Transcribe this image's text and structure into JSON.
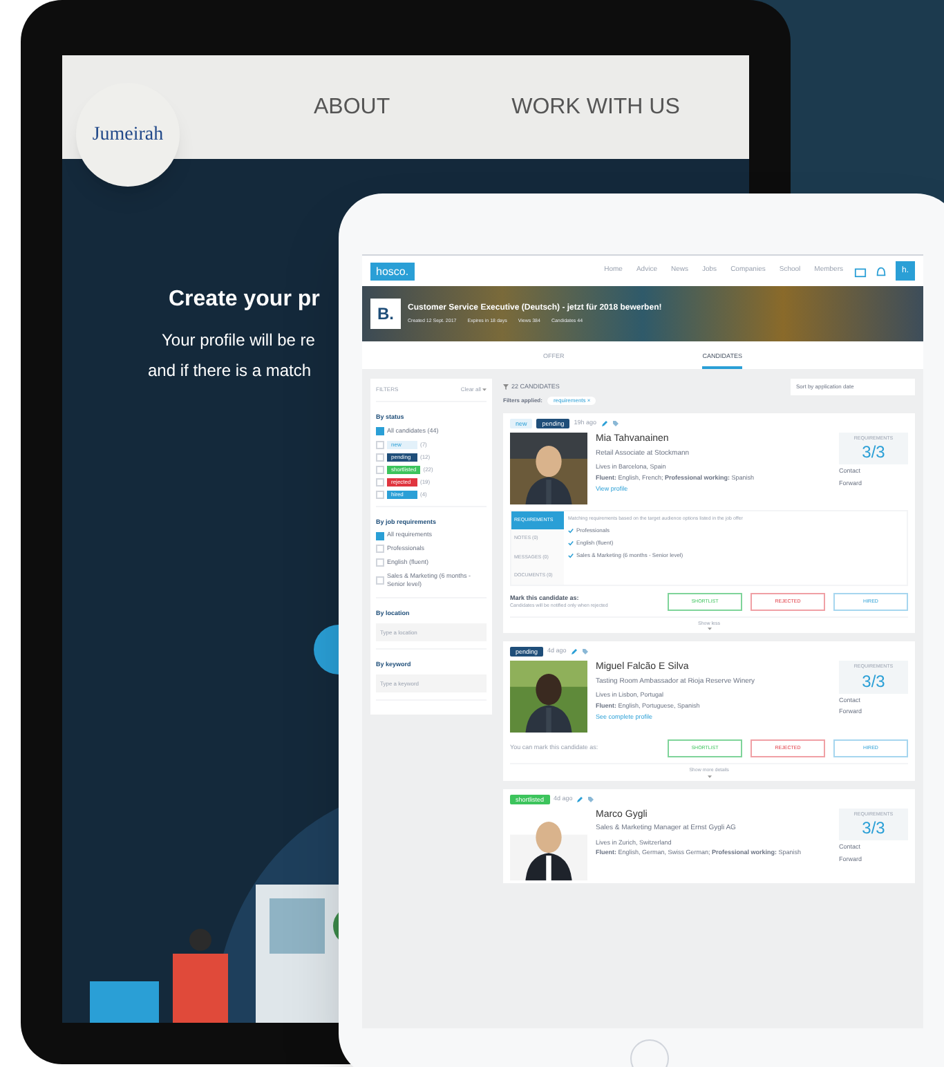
{
  "back_tablet": {
    "logo": "Jumeirah",
    "nav": [
      "ABOUT",
      "WORK WITH US"
    ],
    "headline": "Create your pr",
    "body": [
      "Your profile will be re",
      "and if there is a match"
    ]
  },
  "front_tablet": {
    "topbar": {
      "logo": "hosco.",
      "nav": [
        "Home",
        "Advice",
        "News",
        "Jobs",
        "Companies",
        "School",
        "Members"
      ],
      "avatar": "h."
    },
    "banner": {
      "company_logo": "B.",
      "title": "Customer Service Executive (Deutsch) - jetzt für 2018 bewerben!",
      "meta": [
        "Created 12 Sept. 2017",
        "Expires in 18 days",
        "Views 384",
        "Candidates 44"
      ]
    },
    "tabs": [
      {
        "label": "OFFER",
        "selected": false
      },
      {
        "label": "CANDIDATES",
        "selected": true
      }
    ],
    "filters": {
      "title": "FILTERS",
      "clear": "Clear all",
      "groups": [
        {
          "kind": "checks",
          "title": "By status",
          "items": [
            {
              "label": "All candidates (44)",
              "checked": true
            },
            {
              "label": "new",
              "count": "(7)",
              "color": "#e3f1fa",
              "checked": false
            },
            {
              "label": "pending",
              "count": "(12)",
              "color": "#1f4e79",
              "checked": false
            },
            {
              "label": "shortlisted",
              "count": "(22)",
              "color": "#3cc45c",
              "checked": false
            },
            {
              "label": "rejected",
              "count": "(19)",
              "color": "#e0353f",
              "checked": false
            },
            {
              "label": "hired",
              "count": "(4)",
              "color": "#2a9fd6",
              "checked": false
            }
          ]
        },
        {
          "kind": "checks",
          "title": "By job requirements",
          "items": [
            {
              "label": "All requirements",
              "checked": true
            },
            {
              "label": "Professionals",
              "checked": false
            },
            {
              "label": "English (fluent)",
              "checked": false
            },
            {
              "label": "Sales & Marketing (6 months - Senior level)",
              "checked": false
            }
          ]
        },
        {
          "kind": "field",
          "title": "By location",
          "placeholder": "Type a location"
        },
        {
          "kind": "field",
          "title": "By keyword",
          "placeholder": "Type a keyword"
        }
      ]
    },
    "results": {
      "count": "22 CANDIDATES",
      "sort": "Sort by application date",
      "applied_label": "Filters applied:",
      "applied": [
        "requirements ×"
      ]
    },
    "candidates": [
      {
        "tags": [
          {
            "label": "new",
            "color": "#e3f1fa"
          },
          {
            "label": "pending",
            "color": "#1f4e79"
          }
        ],
        "time": "19h ago",
        "name": "Mia Tahvanainen",
        "role": "Retail Associate at Stockmann",
        "location": "Lives in Barcelona, Spain",
        "languages": "**Fluent:** English, French; **Professional working:** Spanish",
        "link": "View profile",
        "req_label": "REQUIREMENTS",
        "score": "3/3",
        "actions": [
          "Contact",
          "Forward"
        ],
        "detail": {
          "tabs": [
            {
              "label": "REQUIREMENTS",
              "selected": true
            },
            {
              "label": "NOTES (0)",
              "selected": false
            },
            {
              "label": "MESSAGES (0)",
              "selected": false
            },
            {
              "label": "DOCUMENTS (0)",
              "selected": false
            }
          ],
          "intro": "Matching requirements based on the target audience options listed in the job offer",
          "items": [
            "Professionals",
            "English (fluent)",
            "Sales & Marketing (6 months - Senior level)"
          ]
        },
        "mark_label": "Mark this candidate as:",
        "mark_note": "Candidates will be notified only when rejected",
        "buttons": [
          "SHORTLIST",
          "REJECTED",
          "HIRED"
        ],
        "toggle": "Show less"
      },
      {
        "tags": [
          {
            "label": "pending",
            "color": "#1f4e79"
          }
        ],
        "time": "4d ago",
        "name": "Miguel Falcão E Silva",
        "role": "Tasting Room Ambassador at Rioja Reserve Winery",
        "location": "Lives in Lisbon, Portugal",
        "languages": "**Fluent:** English, Portuguese, Spanish",
        "link": "See complete profile",
        "req_label": "REQUIREMENTS",
        "score": "3/3",
        "actions": [
          "Contact",
          "Forward"
        ],
        "mark_label": "You can mark this candidate as:",
        "buttons": [
          "SHORTLIST",
          "REJECTED",
          "HIRED"
        ],
        "toggle": "Show more details"
      },
      {
        "tags": [
          {
            "label": "shortlisted",
            "color": "#3cc45c"
          }
        ],
        "time": "4d ago",
        "name": "Marco Gygli",
        "role": "Sales & Marketing Manager at Ernst Gygli AG",
        "location": "Lives in Zurich, Switzerland",
        "languages": "**Fluent:** English, German, Swiss German; **Professional working:** Spanish",
        "req_label": "REQUIREMENTS",
        "score": "3/3",
        "actions": [
          "Contact",
          "Forward"
        ]
      }
    ]
  }
}
